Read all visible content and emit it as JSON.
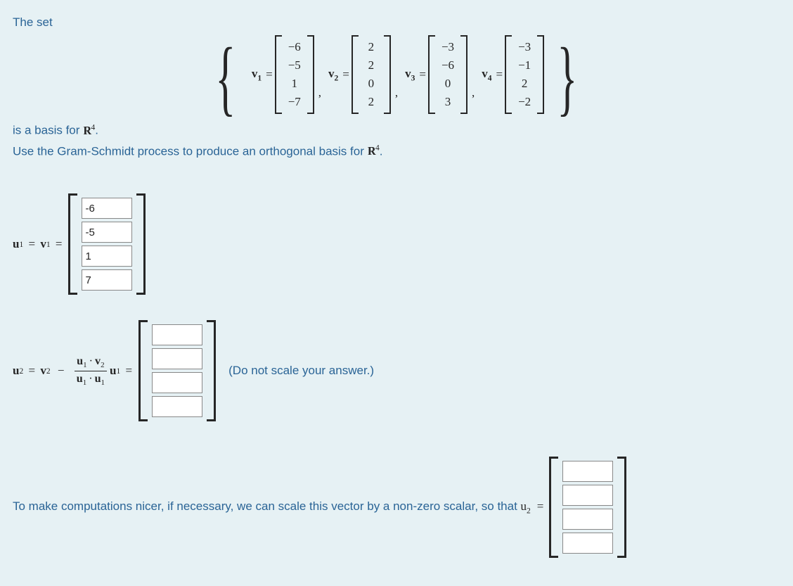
{
  "intro": "The set",
  "basis_line_prefix": "is a basis for ",
  "R_label": "R",
  "R_sup": "4",
  "basis_line_suffix": ".",
  "instruction_prefix": "Use the Gram-Schmidt process to produce an orthogonal basis for ",
  "instruction_suffix": ".",
  "vectors": {
    "v1": {
      "label": "v",
      "sub": "1",
      "entries": [
        "−6",
        "−5",
        "1",
        "−7"
      ]
    },
    "v2": {
      "label": "v",
      "sub": "2",
      "entries": [
        "2",
        "2",
        "0",
        "2"
      ]
    },
    "v3": {
      "label": "v",
      "sub": "3",
      "entries": [
        "−3",
        "−6",
        "0",
        "3"
      ]
    },
    "v4": {
      "label": "v",
      "sub": "4",
      "entries": [
        "−3",
        "−1",
        "2",
        "−2"
      ]
    }
  },
  "u1": {
    "lhs_u": "u",
    "lhs_sub": "1",
    "rhs_v": "v",
    "rhs_sub": "1",
    "values": [
      "-6",
      "-5",
      "1",
      "7"
    ]
  },
  "u2": {
    "lhs_u": "u",
    "lhs_sub": "2",
    "v_label": "v",
    "v_sub": "2",
    "minus": "−",
    "num_u": "u",
    "num_usub": "1",
    "num_dot": "·",
    "num_v": "v",
    "num_vsub": "2",
    "den_u_a": "u",
    "den_ua_sub": "1",
    "den_dot": "·",
    "den_u_b": "u",
    "den_ub_sub": "1",
    "trail_u": "u",
    "trail_sub": "1",
    "values": [
      "",
      "",
      "",
      ""
    ],
    "hint": "(Do not scale your answer.)"
  },
  "final_line_prefix": "To make computations nicer, if necessary, we can scale this vector by a non-zero scalar, so that ",
  "final_u": "u",
  "final_sub": "2",
  "final_eq": "=",
  "final_values": [
    "",
    "",
    "",
    ""
  ]
}
